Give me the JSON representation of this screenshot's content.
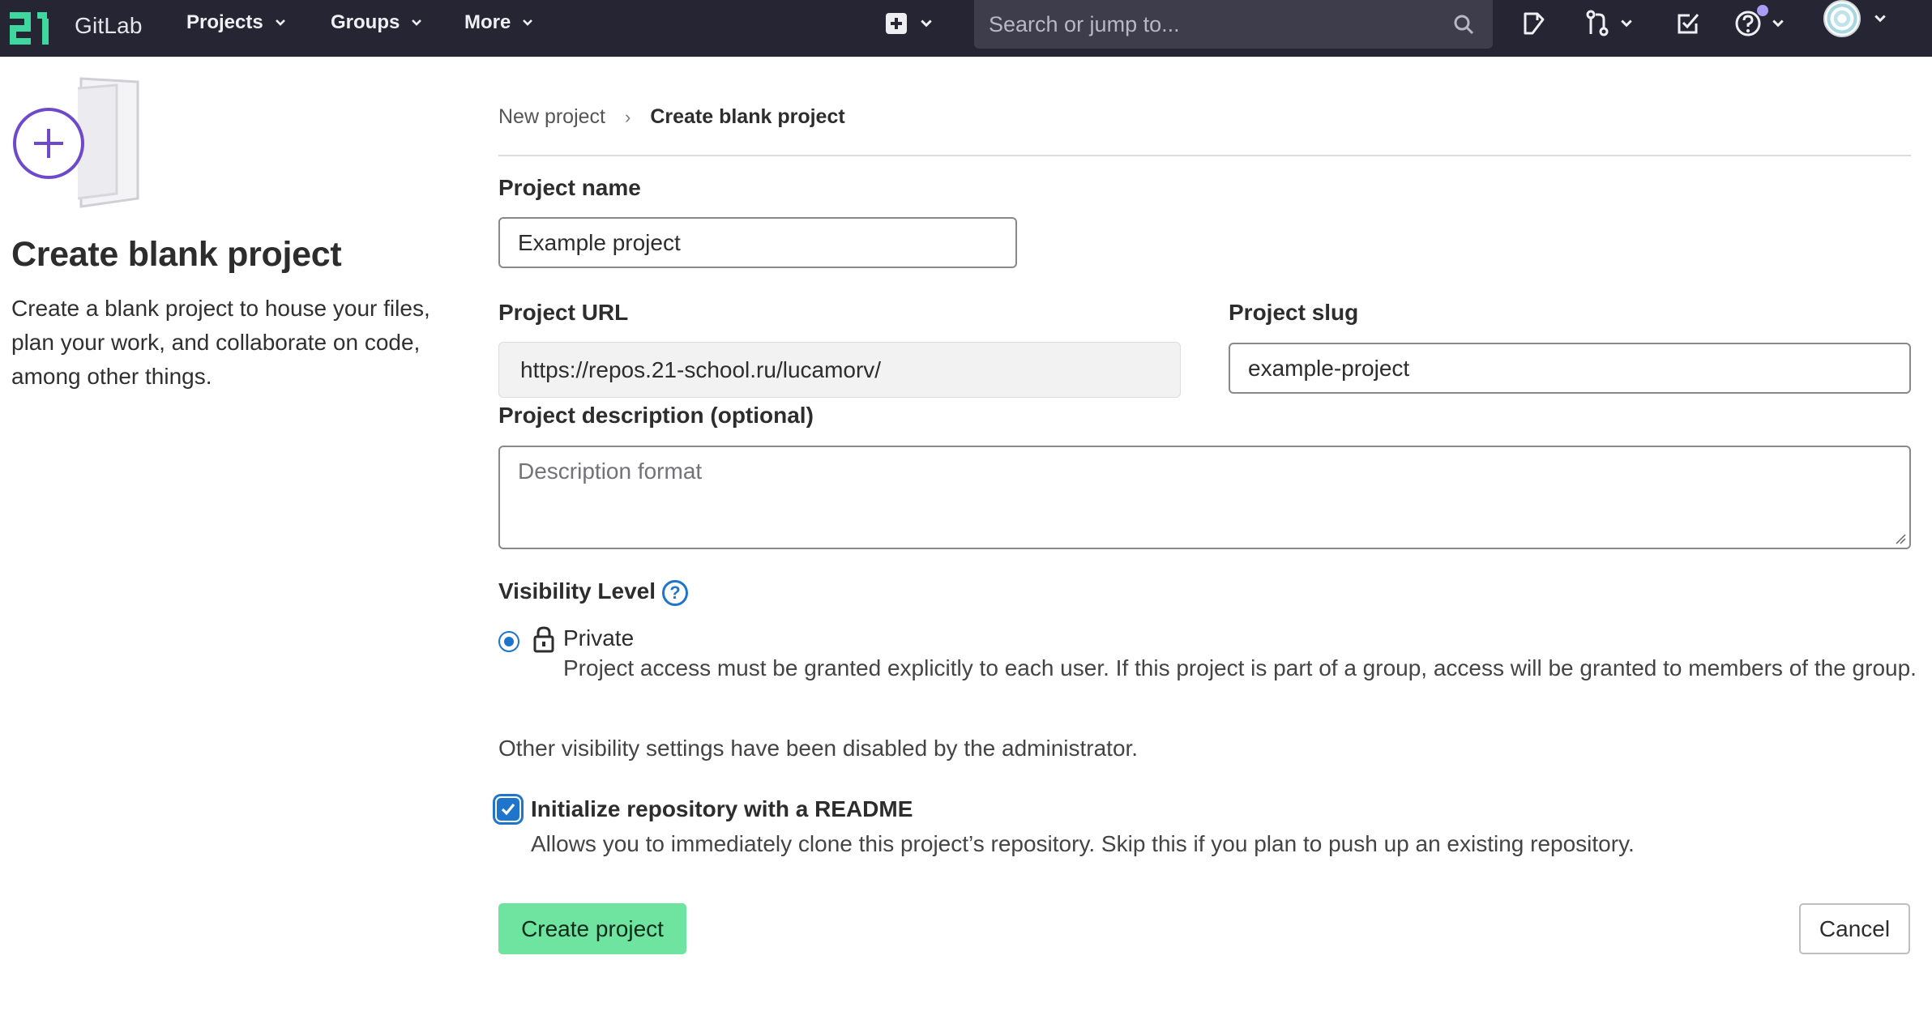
{
  "navbar": {
    "brand": "GitLab",
    "menus": [
      {
        "label": "Projects"
      },
      {
        "label": "Groups"
      },
      {
        "label": "More"
      }
    ],
    "search_placeholder": "Search or jump to...",
    "icons": [
      "new-item-icon",
      "issues-icon",
      "merge-requests-icon",
      "todos-icon",
      "help-icon",
      "user-avatar"
    ]
  },
  "intro": {
    "title": "Create blank project",
    "description": "Create a blank project to house your files, plan your work, and collaborate on code, among other things."
  },
  "breadcrumb": {
    "parent": "New project",
    "current": "Create blank project"
  },
  "form": {
    "project_name_label": "Project name",
    "project_name_value": "Example project",
    "project_url_label": "Project URL",
    "project_url_value": "https://repos.21-school.ru/lucamorv/",
    "project_slug_label": "Project slug",
    "project_slug_value": "example-project",
    "description_label": "Project description (optional)",
    "description_placeholder": "Description format",
    "visibility_label": "Visibility Level",
    "visibility_help": "?",
    "visibility_option": "Private",
    "visibility_option_desc": "Project access must be granted explicitly to each user. If this project is part of a group, access will be granted to members of the group.",
    "visibility_note": "Other visibility settings have been disabled by the administrator.",
    "readme_label": "Initialize repository with a README",
    "readme_checked": true,
    "readme_help": "Allows you to immediately clone this project’s repository. Skip this if you plan to push up an existing repository.",
    "create_button": "Create project",
    "cancel_button": "Cancel"
  },
  "colors": {
    "navbar_bg": "#262533",
    "primary": "#1f75cb",
    "create_button_bg": "#6fe3a0",
    "illustration_accent": "#6e49cb"
  }
}
